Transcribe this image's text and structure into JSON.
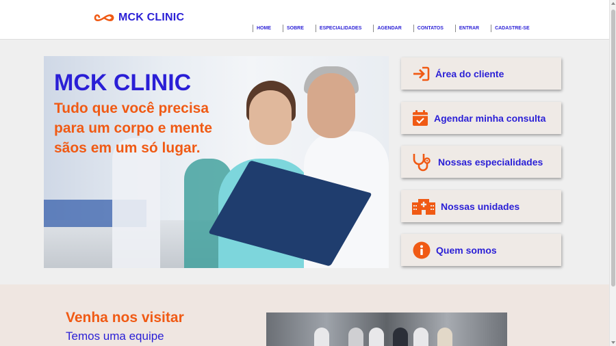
{
  "brand": {
    "name": "MCK CLINIC",
    "accent": "#f05a14",
    "primary": "#2a1fd6",
    "logo_icon": "infinity-icon"
  },
  "nav": {
    "items": [
      {
        "label": "HOME"
      },
      {
        "label": "SOBRE"
      },
      {
        "label": "ESPECIALIDADES"
      },
      {
        "label": "AGENDAR"
      },
      {
        "label": "CONTATOS"
      },
      {
        "label": "ENTRAR"
      },
      {
        "label": "CADASTRE-SE"
      }
    ]
  },
  "hero": {
    "title": "MCK CLINIC",
    "tagline": "Tudo que você precisa para um corpo e mente sãos em um só lugar."
  },
  "cards": [
    {
      "label": "Área do cliente",
      "icon": "sign-in-icon"
    },
    {
      "label": "Agendar minha consulta",
      "icon": "calendar-check-icon"
    },
    {
      "label": "Nossas especialidades",
      "icon": "stethoscope-icon"
    },
    {
      "label": "Nossas unidades",
      "icon": "hospital-icon"
    },
    {
      "label": "Quem somos",
      "icon": "info-circle-icon"
    }
  ],
  "visit": {
    "title": "Venha nos visitar",
    "text": "Temos uma equipe"
  }
}
